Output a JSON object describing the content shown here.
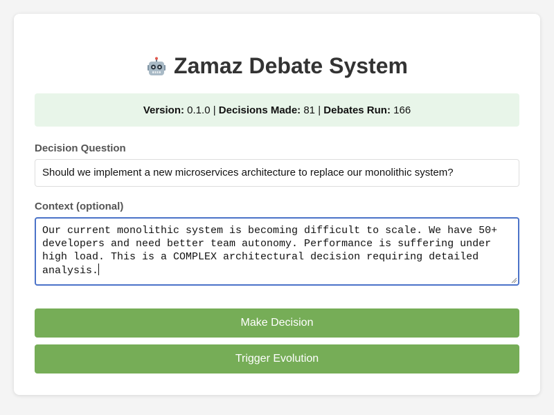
{
  "app": {
    "title": "Zamaz Debate System",
    "icon": "robot-icon"
  },
  "stats": {
    "version_label": "Version:",
    "version_value": "0.1.0",
    "separator": "|",
    "decisions_label": "Decisions Made:",
    "decisions_value": "81",
    "debates_label": "Debates Run:",
    "debates_value": "166"
  },
  "form": {
    "question_label": "Decision Question",
    "question_value": "Should we implement a new microservices architecture to replace our monolithic system?",
    "context_label": "Context (optional)",
    "context_value": "Our current monolithic system is becoming difficult to scale. We have 50+ developers and need better team autonomy. Performance is suffering under high load. This is a COMPLEX architectural decision requiring detailed analysis."
  },
  "buttons": {
    "make_decision": "Make Decision",
    "trigger_evolution": "Trigger Evolution"
  },
  "colors": {
    "button": "#76ad57",
    "stats_bg": "#e8f5e9",
    "focus_border": "#4a72c8"
  }
}
